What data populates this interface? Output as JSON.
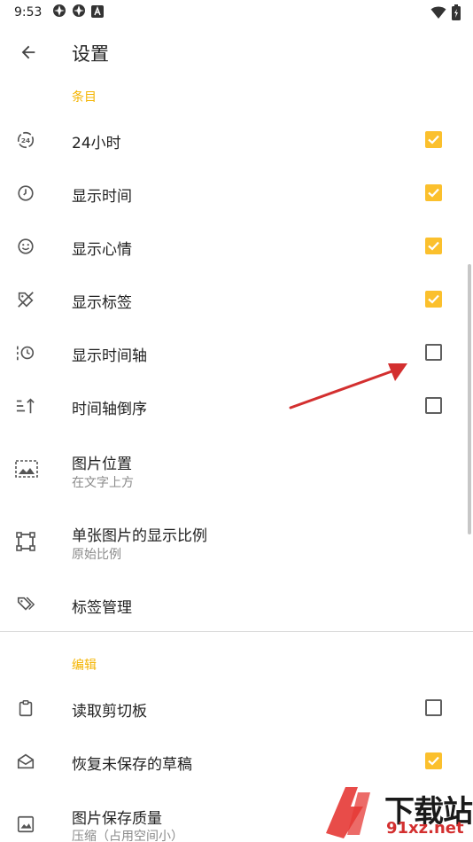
{
  "status_bar": {
    "time": "9:53",
    "icons": [
      "app-icon-1",
      "app-icon-2",
      "a-letter-icon"
    ],
    "right_icons": [
      "wifi-icon",
      "battery-icon"
    ]
  },
  "toolbar": {
    "title": "设置",
    "back_icon": "arrow-back-icon"
  },
  "sections": {
    "items": "条目",
    "edit": "编辑"
  },
  "prefs": [
    {
      "title": "24小时",
      "checked": true
    },
    {
      "title": "显示时间",
      "checked": true
    },
    {
      "title": "显示心情",
      "checked": true
    },
    {
      "title": "显示标签",
      "checked": true
    },
    {
      "title": "显示时间轴",
      "checked": false
    },
    {
      "title": "时间轴倒序",
      "checked": false
    },
    {
      "title": "图片位置",
      "summary": "在文字上方"
    },
    {
      "title": "单张图片的显示比例",
      "summary": "原始比例"
    },
    {
      "title": "标签管理"
    },
    {
      "title": "读取剪切板",
      "checked": false
    },
    {
      "title": "恢复未保存的草稿",
      "checked": true
    },
    {
      "title": "图片保存质量",
      "summary": "压缩（占用空间小）"
    }
  ],
  "watermark": {
    "big": "下载站",
    "small": "91xz.net"
  },
  "colors": {
    "accent": "#FBC02D",
    "section": "#F4B400"
  }
}
